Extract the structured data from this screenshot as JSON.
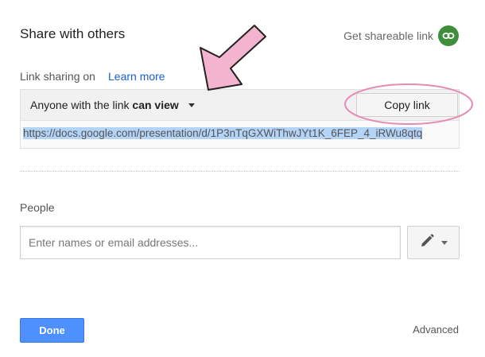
{
  "dialog": {
    "title": "Share with others",
    "get_link_label": "Get shareable link",
    "get_link_icon": "link-icon",
    "link_sharing_label": "Link sharing on",
    "learn_more": "Learn more",
    "access_prefix": "Anyone with the link ",
    "access_level": "can view",
    "copy_button": "Copy link",
    "url": "https://docs.google.com/presentation/d/1P3nTqGXWiThwJYt1K_6FEP_4_iRWu8qtq",
    "people_label": "People",
    "people_placeholder": "Enter names or email addresses...",
    "permission_icon": "pencil-icon",
    "done_button": "Done",
    "advanced_link": "Advanced"
  },
  "annotations": {
    "arrow_color": "#f4b3cf",
    "circle_color": "#e68bb5"
  },
  "colors": {
    "accent_blue": "#4d90fe",
    "link_green": "#3e8e3b",
    "link_text": "#1a5fd4"
  }
}
